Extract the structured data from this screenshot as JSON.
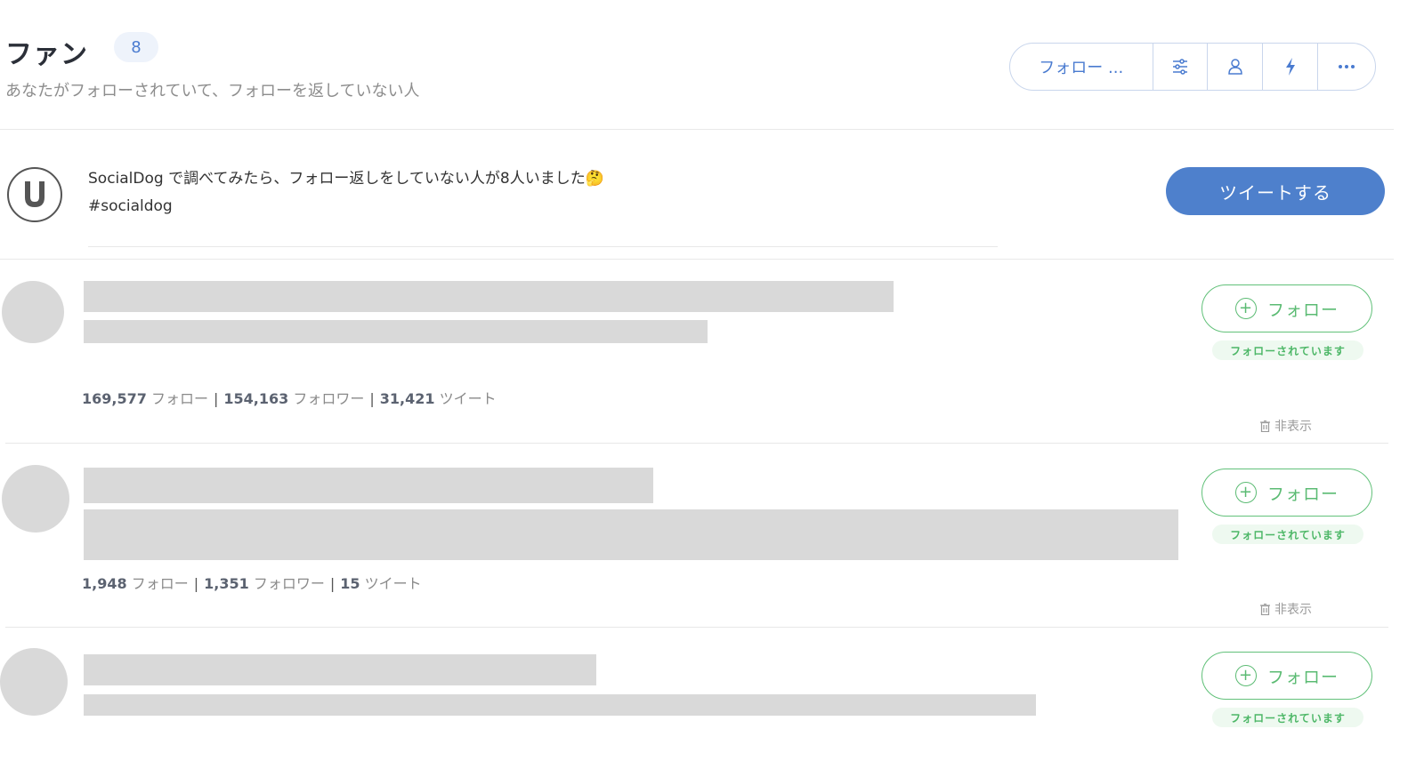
{
  "header": {
    "title": "ファン",
    "count": "8",
    "subtitle": "あなたがフォローされていて、フォローを返していない人"
  },
  "toolbar": {
    "sort_label": "フォロー ...",
    "icons": [
      "filter-sliders-icon",
      "user-icon",
      "bolt-icon",
      "more-dots-icon"
    ]
  },
  "promo": {
    "line1": "SocialDog で調べてみたら、フォロー返しをしていない人が8人いました🤔",
    "line2": "#socialdog",
    "tweet_button": "ツイートする",
    "avatar_letter": "U"
  },
  "users": [
    {
      "following": "169,577",
      "following_label": "フォロー",
      "followers": "154,163",
      "followers_label": "フォロワー",
      "tweets": "31,421",
      "tweets_label": "ツイート"
    },
    {
      "following": "1,948",
      "following_label": "フォロー",
      "followers": "1,351",
      "followers_label": "フォロワー",
      "tweets": "15",
      "tweets_label": "ツイート"
    },
    {}
  ],
  "actions": {
    "follow_label": "フォロー",
    "followed_badge": "フォローされています",
    "hide_label": "非表示"
  },
  "colors": {
    "accent_blue": "#4e80cc",
    "follow_green": "#5bbb73",
    "redacted_gray": "#d9d9d9"
  }
}
